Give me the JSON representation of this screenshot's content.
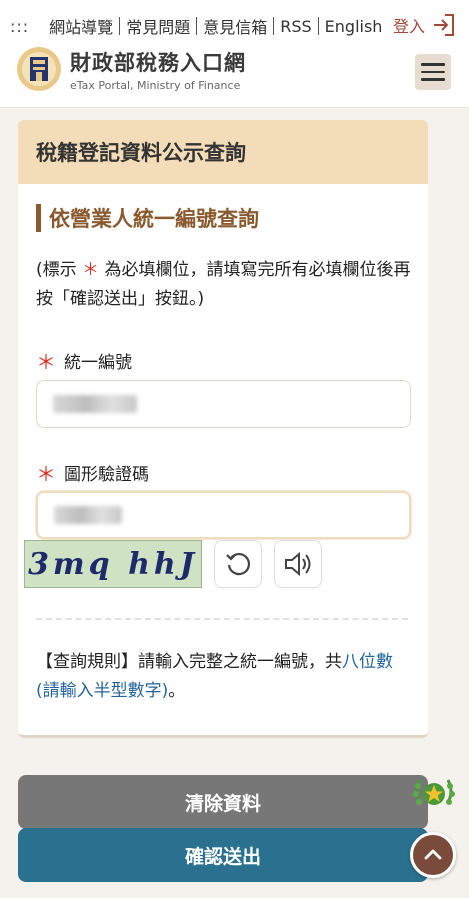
{
  "header": {
    "menu_dots": ":::",
    "nav_links": [
      "網站導覽",
      "常見問題",
      "意見信箱",
      "RSS",
      "English"
    ],
    "login_label": "登入",
    "logo_title": "財政部稅務入口網",
    "logo_subtitle": "eTax Portal, Ministry of Finance"
  },
  "card": {
    "title": "稅籍登記資料公示查詢",
    "section_title": "依營業人統一編號查詢",
    "note_prefix": "(標示",
    "note_star": "＊",
    "note_suffix": "為必填欄位，請填寫完所有必填欄位後再按「確認送出」按鈕。)",
    "fields": [
      {
        "label": "統一編號",
        "required_mark": "＊"
      },
      {
        "label": "圖形驗證碼",
        "required_mark": "＊"
      }
    ],
    "captcha_text": "3mq hhJ",
    "rule_prefix": "【查詢規則】請輸入完整之統一編號，共",
    "rule_link": "八位數(請輸入半型數字)",
    "rule_suffix": "。"
  },
  "buttons": {
    "clear": "清除資料",
    "submit": "確認送出"
  },
  "colors": {
    "header_band": "#f3ddb9",
    "section_accent": "#8a5a2e",
    "required": "#d9342b",
    "link": "#23659a",
    "submit": "#2a718f",
    "clear": "#777777"
  }
}
